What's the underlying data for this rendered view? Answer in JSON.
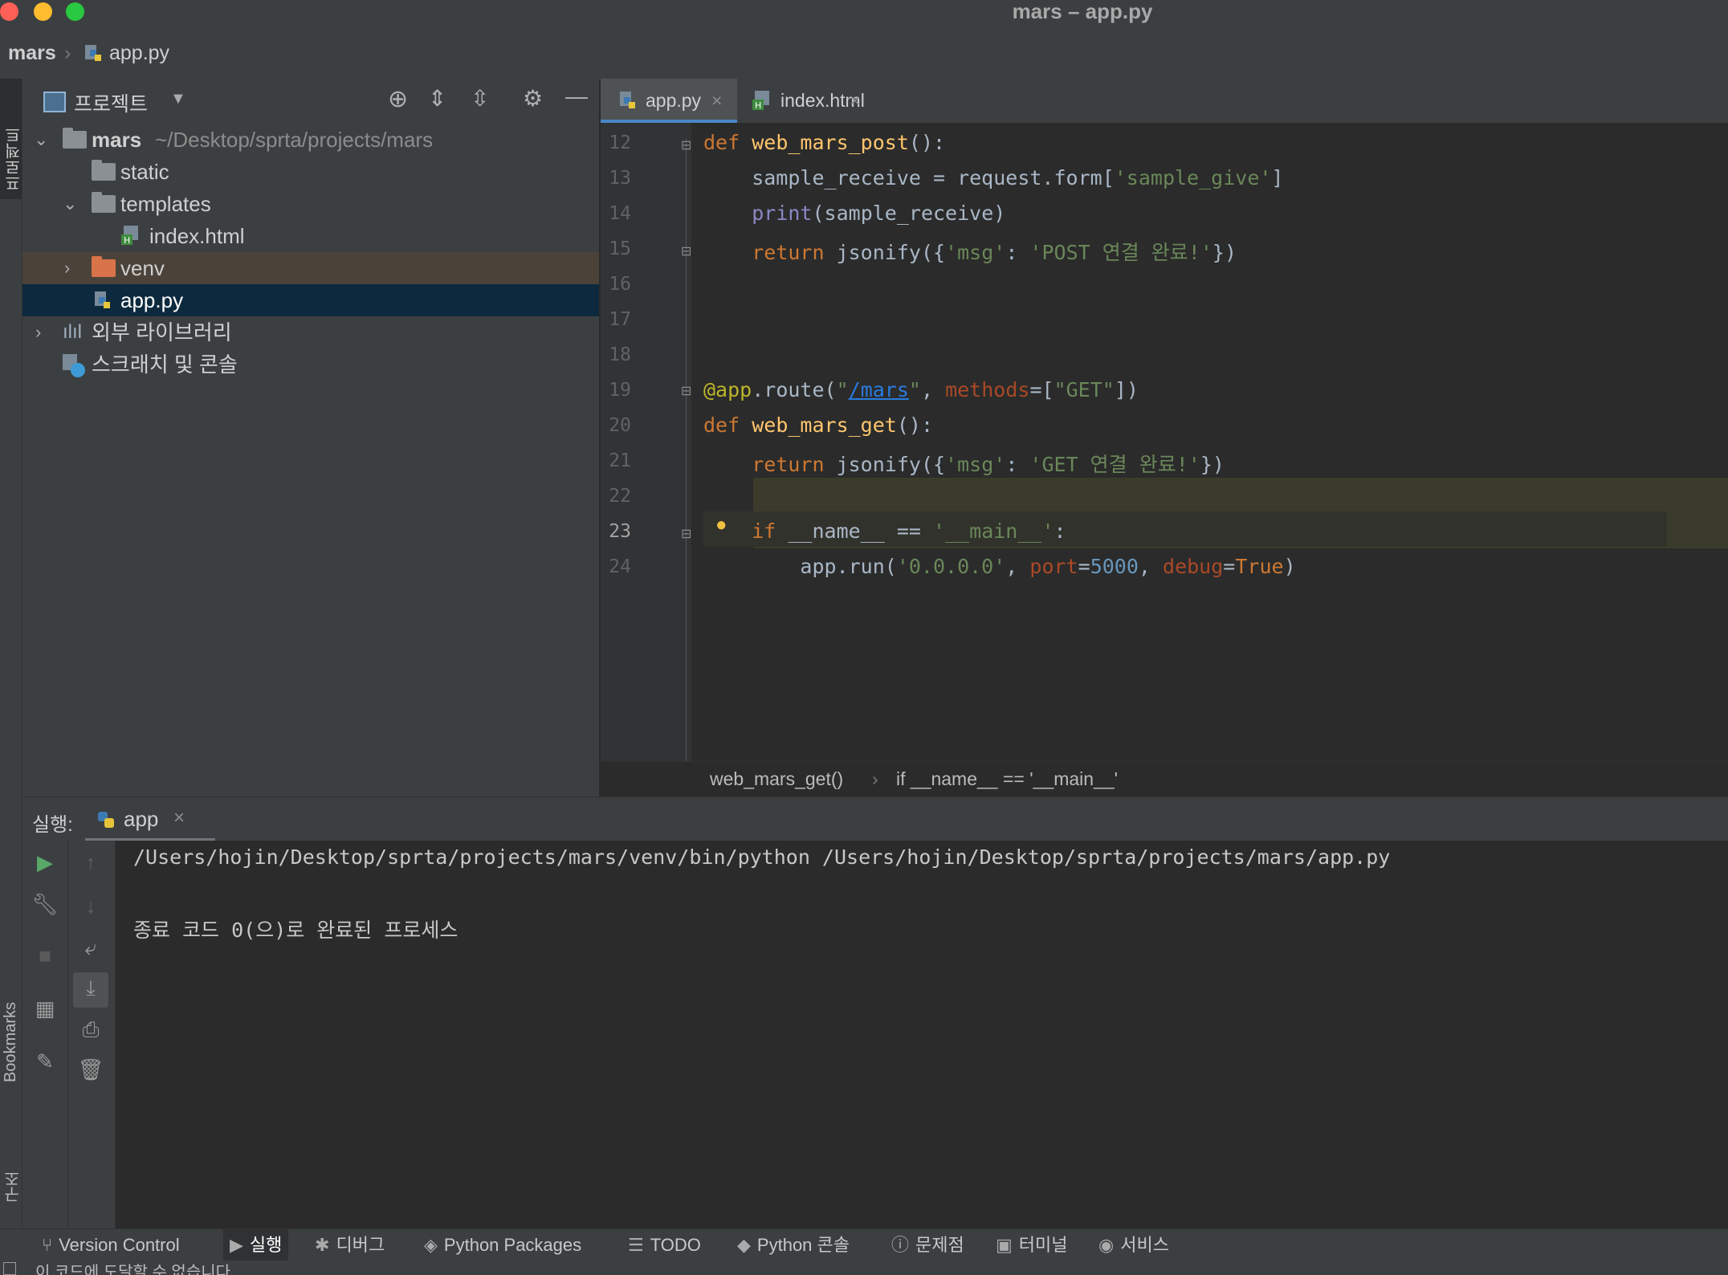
{
  "window": {
    "title": "mars – app.py"
  },
  "navbar": {
    "project": "mars",
    "file": "app.py"
  },
  "project_panel": {
    "title": "프로젝트",
    "tree": [
      {
        "name": "mars",
        "path": "~/Desktop/sprta/projects/mars"
      },
      {
        "name": "static"
      },
      {
        "name": "templates"
      },
      {
        "name": "index.html"
      },
      {
        "name": "venv"
      },
      {
        "name": "app.py"
      },
      {
        "name": "외부 라이브러리"
      },
      {
        "name": "스크래치 및 콘솔"
      }
    ]
  },
  "editor": {
    "tabs": [
      {
        "label": "app.py"
      },
      {
        "label": "index.html"
      }
    ],
    "line_numbers": [
      "12",
      "13",
      "14",
      "15",
      "16",
      "17",
      "18",
      "19",
      "20",
      "21",
      "22",
      "23",
      "24"
    ],
    "breadcrumb": {
      "item1": "web_mars_get()",
      "item2": "if __name__ == '__main__'"
    }
  },
  "run_panel": {
    "label": "실행:",
    "config": "app",
    "output": [
      "/Users/hojin/Desktop/sprta/projects/mars/venv/bin/python /Users/hojin/Desktop/sprta/projects/mars/app.py",
      "종료 코드 0(으)로 완료된 프로세스"
    ]
  },
  "left_strip": {
    "project_label": "프로젝트",
    "bookmarks_label": "Bookmarks",
    "structure_label": "구조"
  },
  "bottom_tools": {
    "version_control": "Version Control",
    "run": "실행",
    "debug": "디버그",
    "python_packages": "Python Packages",
    "todo": "TODO",
    "python_console": "Python 콘솔",
    "problems": "문제점",
    "terminal": "터미널",
    "services": "서비스"
  },
  "status": {
    "message": "이 코드에 도달할 수 없습니다"
  },
  "colors": {
    "accent": "#4a88c7",
    "selection": "#0d293e",
    "venv_highlight": "#4b4339",
    "current_block": "#3b3b2b"
  }
}
